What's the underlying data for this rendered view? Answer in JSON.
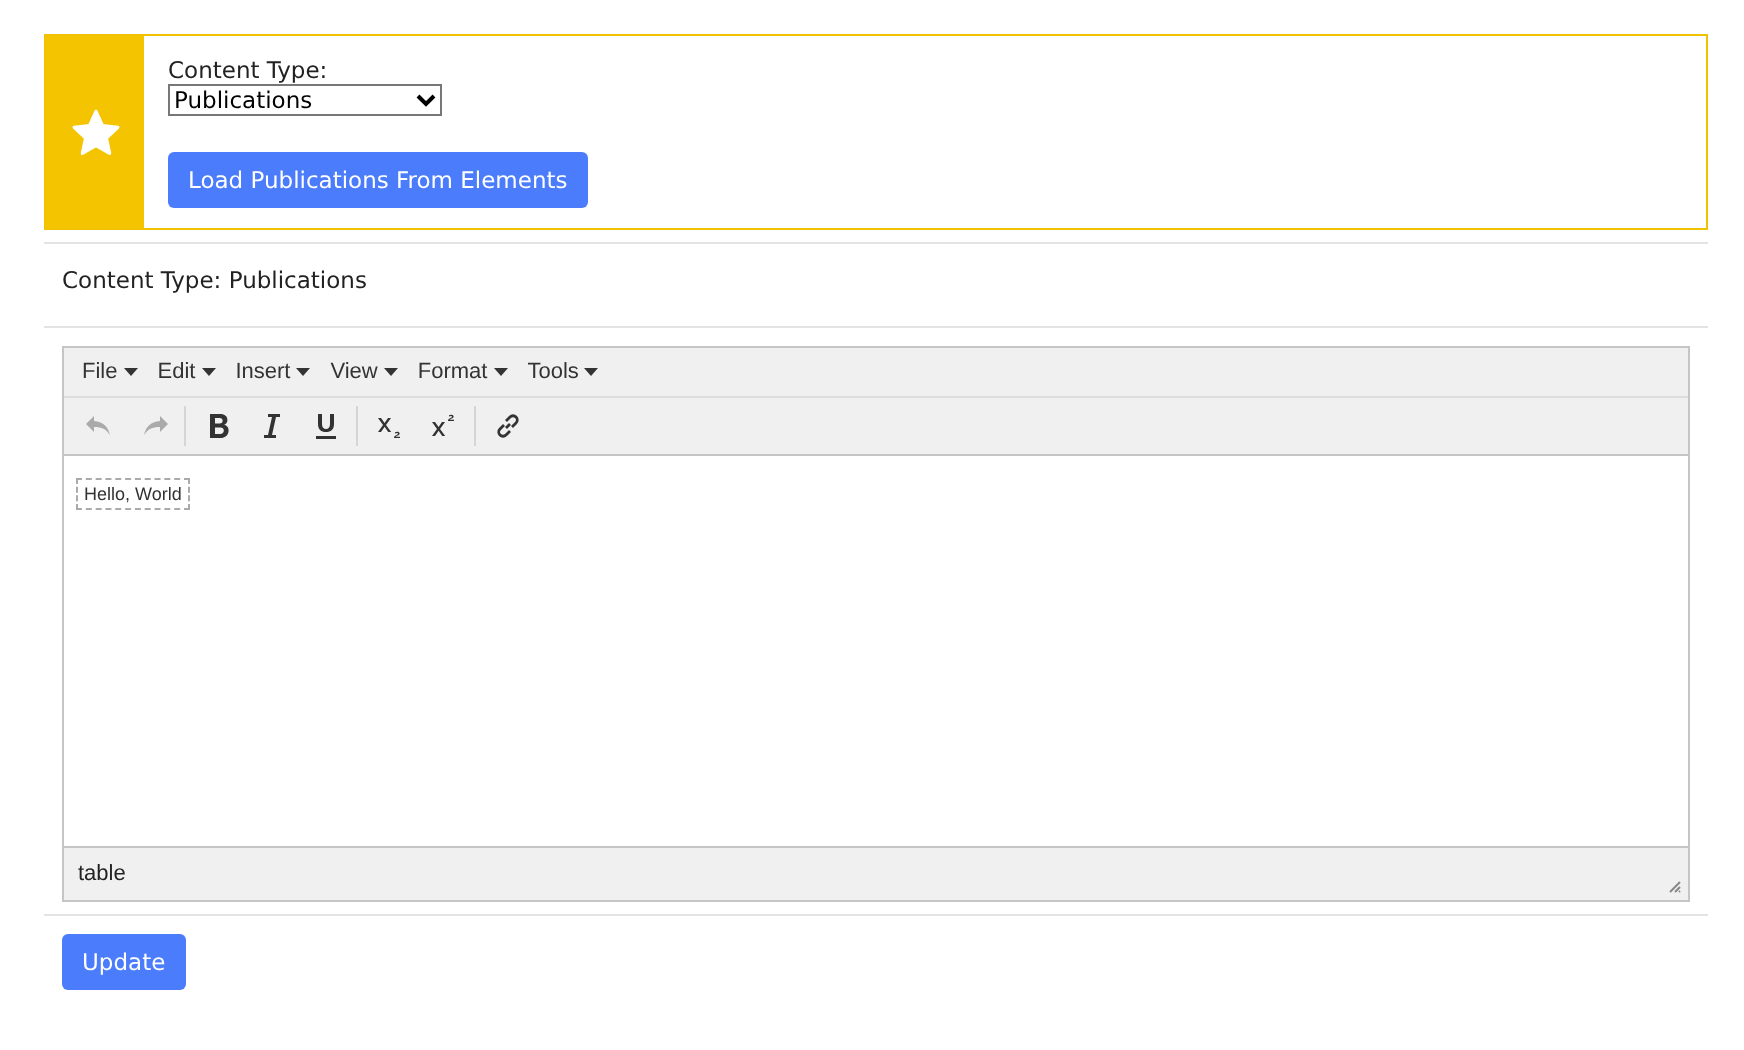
{
  "panel": {
    "label": "Content Type:",
    "select": {
      "value": "Publications"
    },
    "button": "Load Publications From Elements"
  },
  "content_type_line": "Content Type: Publications",
  "editor": {
    "menus": [
      "File",
      "Edit",
      "Insert",
      "View",
      "Format",
      "Tools"
    ],
    "toolbar": [
      {
        "kind": "undo",
        "disabled": true
      },
      {
        "kind": "redo",
        "disabled": true
      },
      {
        "kind": "sep"
      },
      {
        "kind": "bold",
        "disabled": false
      },
      {
        "kind": "italic",
        "disabled": false
      },
      {
        "kind": "underline",
        "disabled": false
      },
      {
        "kind": "sep"
      },
      {
        "kind": "subscript",
        "disabled": false
      },
      {
        "kind": "superscript",
        "disabled": false
      },
      {
        "kind": "sep"
      },
      {
        "kind": "link",
        "disabled": false
      }
    ],
    "body_text": "Hello, World",
    "status_path": "table"
  },
  "update_button": "Update"
}
